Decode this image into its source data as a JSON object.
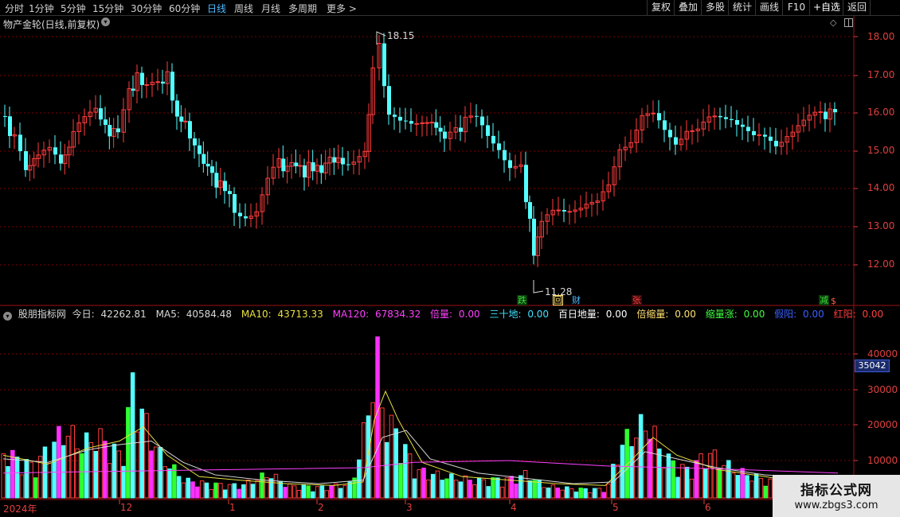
{
  "toolbar": {
    "periods": [
      "分时",
      "1分钟",
      "5分钟",
      "15分钟",
      "30分钟",
      "60分钟",
      "日线",
      "周线",
      "月线",
      "多周期",
      "更多 >"
    ],
    "active_period": "日线",
    "right_buttons": [
      "复权",
      "叠加",
      "多股",
      "统计",
      "画线",
      "F10",
      "+自选",
      "返回"
    ]
  },
  "stock_title": "物产金轮(日线,前复权)",
  "price_axis": [
    "18.00",
    "17.00",
    "16.00",
    "15.00",
    "14.00",
    "13.00",
    "12.00"
  ],
  "high_label": "18.15",
  "low_label": "11.28",
  "event_markers": [
    {
      "text": "跌",
      "color": "#3cdc3c"
    },
    {
      "text": "回",
      "color": "#ffe070"
    },
    {
      "text": "财",
      "color": "#4fb9ff"
    },
    {
      "text": "张",
      "color": "#ff4040"
    },
    {
      "text": "减",
      "color": "#3cdc3c"
    },
    {
      "text": "$",
      "color": "#ff6040"
    }
  ],
  "indicator": {
    "name": "股朋指标网",
    "items": [
      {
        "label": "今日:",
        "value": "42262.81",
        "color": "#d8d8d8"
      },
      {
        "label": "MA5:",
        "value": "40584.48",
        "color": "#d8d8d8"
      },
      {
        "label": "MA10:",
        "value": "43713.33",
        "color": "#e8e040"
      },
      {
        "label": "MA120:",
        "value": "67834.32",
        "color": "#ff40ff"
      },
      {
        "label": "倍量:",
        "value": "0.00",
        "color": "#ff40ff"
      },
      {
        "label": "三十地:",
        "value": "0.00",
        "color": "#40e0ff"
      },
      {
        "label": "百日地量:",
        "value": "0.00",
        "color": "#ffffff"
      },
      {
        "label": "倍缩量:",
        "value": "0.00",
        "color": "#ffe070"
      },
      {
        "label": "缩量涨:",
        "value": "0.00",
        "color": "#40ff40"
      },
      {
        "label": "假阳:",
        "value": "0.00",
        "color": "#3a60ff"
      },
      {
        "label": "红阳:",
        "value": "0.00",
        "color": "#ff4040"
      }
    ]
  },
  "volume_axis": [
    "40000",
    "30000",
    "20000",
    "10000"
  ],
  "volume_current": "35042",
  "date_axis": [
    "2024年",
    "12",
    "1",
    "2",
    "3",
    "4",
    "5",
    "6"
  ],
  "watermark": {
    "line1": "指标公式网",
    "line2": "www.zbgs3.com"
  },
  "colors": {
    "up": "#ff3c3c",
    "down": "#54ffff",
    "grid": "#7a0000",
    "axis": "#e04040"
  }
}
